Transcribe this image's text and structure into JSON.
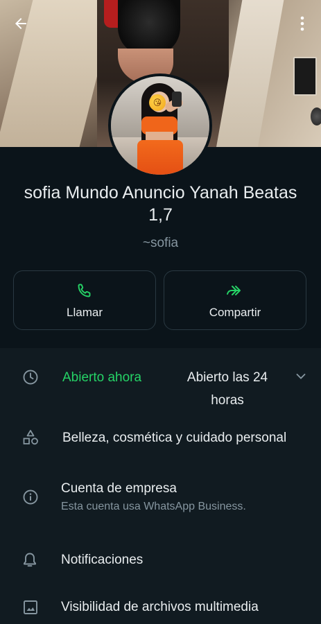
{
  "header": {
    "back_icon": "arrow-left-icon",
    "menu_icon": "more-vertical-icon"
  },
  "profile": {
    "name": "sofia Mundo Anuncio Yanah Beatas 1,7",
    "pushname": "~sofia",
    "avatar_emoji": "😘"
  },
  "actions": [
    {
      "label": "Llamar",
      "icon": "phone-icon"
    },
    {
      "label": "Compartir",
      "icon": "share-forward-icon"
    }
  ],
  "business": {
    "hours_status": "Abierto ahora",
    "hours_value": "Abierto las 24 horas",
    "category": "Belleza, cosmética y cuidado personal",
    "account_title": "Cuenta de empresa",
    "account_subtitle": "Esta cuenta usa WhatsApp Business."
  },
  "settings": {
    "notifications": "Notificaciones",
    "media_visibility": "Visibilidad de archivos multimedia"
  },
  "colors": {
    "background": "#0b141a",
    "section": "#111b21",
    "accent_green": "#25d366",
    "text_primary": "#e9edef",
    "text_secondary": "#8696a0"
  }
}
